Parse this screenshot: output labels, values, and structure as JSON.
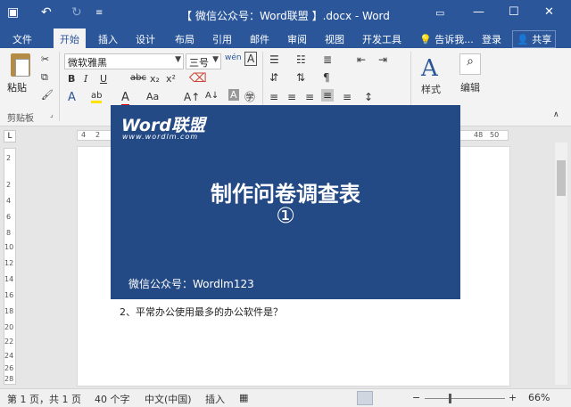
{
  "app": {
    "title": "【 微信公众号：Word联盟 】.docx - Word"
  },
  "quick_access": {
    "save_icon": "save-icon",
    "undo_icon": "undo-icon",
    "redo_icon": "redo-icon",
    "customize_icon": "customize-icon"
  },
  "window": {
    "minimize": "—",
    "restore": "☐",
    "close": "✕"
  },
  "tabs": [
    "文件",
    "开始",
    "插入",
    "设计",
    "布局",
    "引用",
    "邮件",
    "审阅",
    "视图",
    "开发工具"
  ],
  "tell_me": "告诉我...",
  "login": "登录",
  "share": "共享",
  "ribbon": {
    "paste_label": "粘贴",
    "clipboard_label": "剪贴板",
    "font_name": "微软雅黑",
    "font_size": "三号",
    "styles_label": "样式",
    "edit_label": "编辑",
    "bold": "B",
    "italic": "I",
    "underline": "U",
    "strike": "abc",
    "subscript": "x₂",
    "superscript": "x²",
    "font_color": "A",
    "change_case": "Aa"
  },
  "ruler": {
    "corner": "L",
    "top_marks": [
      "4",
      "2",
      "48",
      "50"
    ],
    "left_marks": [
      "2",
      "2",
      "4",
      "6",
      "8",
      "10",
      "12",
      "14",
      "16",
      "18",
      "20",
      "22",
      "24",
      "26",
      "28"
    ]
  },
  "overlay": {
    "logo": "Word联盟",
    "logo_url": "www.wordlm.com",
    "title": "制作问卷调查表",
    "number": "①",
    "footer": "微信公众号：Wordlm123"
  },
  "document": {
    "line": "2、平常办公使用最多的办公软件是？"
  },
  "status": {
    "page": "第 1 页，共 1 页",
    "words": "40 个字",
    "language": "中文(中国)",
    "mode": "插入",
    "zoom": "66%",
    "zoom_level": 0.66
  }
}
